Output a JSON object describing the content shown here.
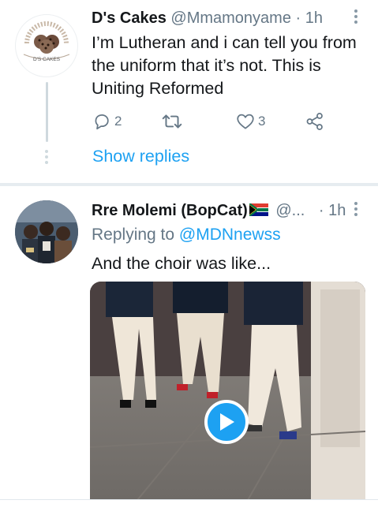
{
  "tweets": [
    {
      "author_name": "D's Cakes",
      "handle": "@Mmamonyame",
      "time": "· 1h",
      "avatar_label": "D'S CAKES",
      "avatar_icon": "cake-logo-avatar",
      "text_lines": [
        "I’m Lutheran and i can tell you from",
        "the uniform that it’s not. This is",
        "Uniting Reformed"
      ],
      "reply_count": "2",
      "retweet_count": "",
      "like_count": "3",
      "show_replies": "Show replies"
    },
    {
      "author_name": "Rre Molemi (BopCat)",
      "flag_icon": "south-africa-flag-icon",
      "handle": "@...",
      "time": "· 1h",
      "avatar_icon": "group-photo-avatar",
      "replying_prefix": "Replying to",
      "replying_handle": "@MDNnewss",
      "text": "And the choir was like...",
      "media_type": "video",
      "media_icon": "play-icon"
    }
  ],
  "colors": {
    "accent": "#1da1f2",
    "secondary_text": "#657786",
    "primary_text": "#14171a",
    "separator": "#e6ecf0"
  }
}
